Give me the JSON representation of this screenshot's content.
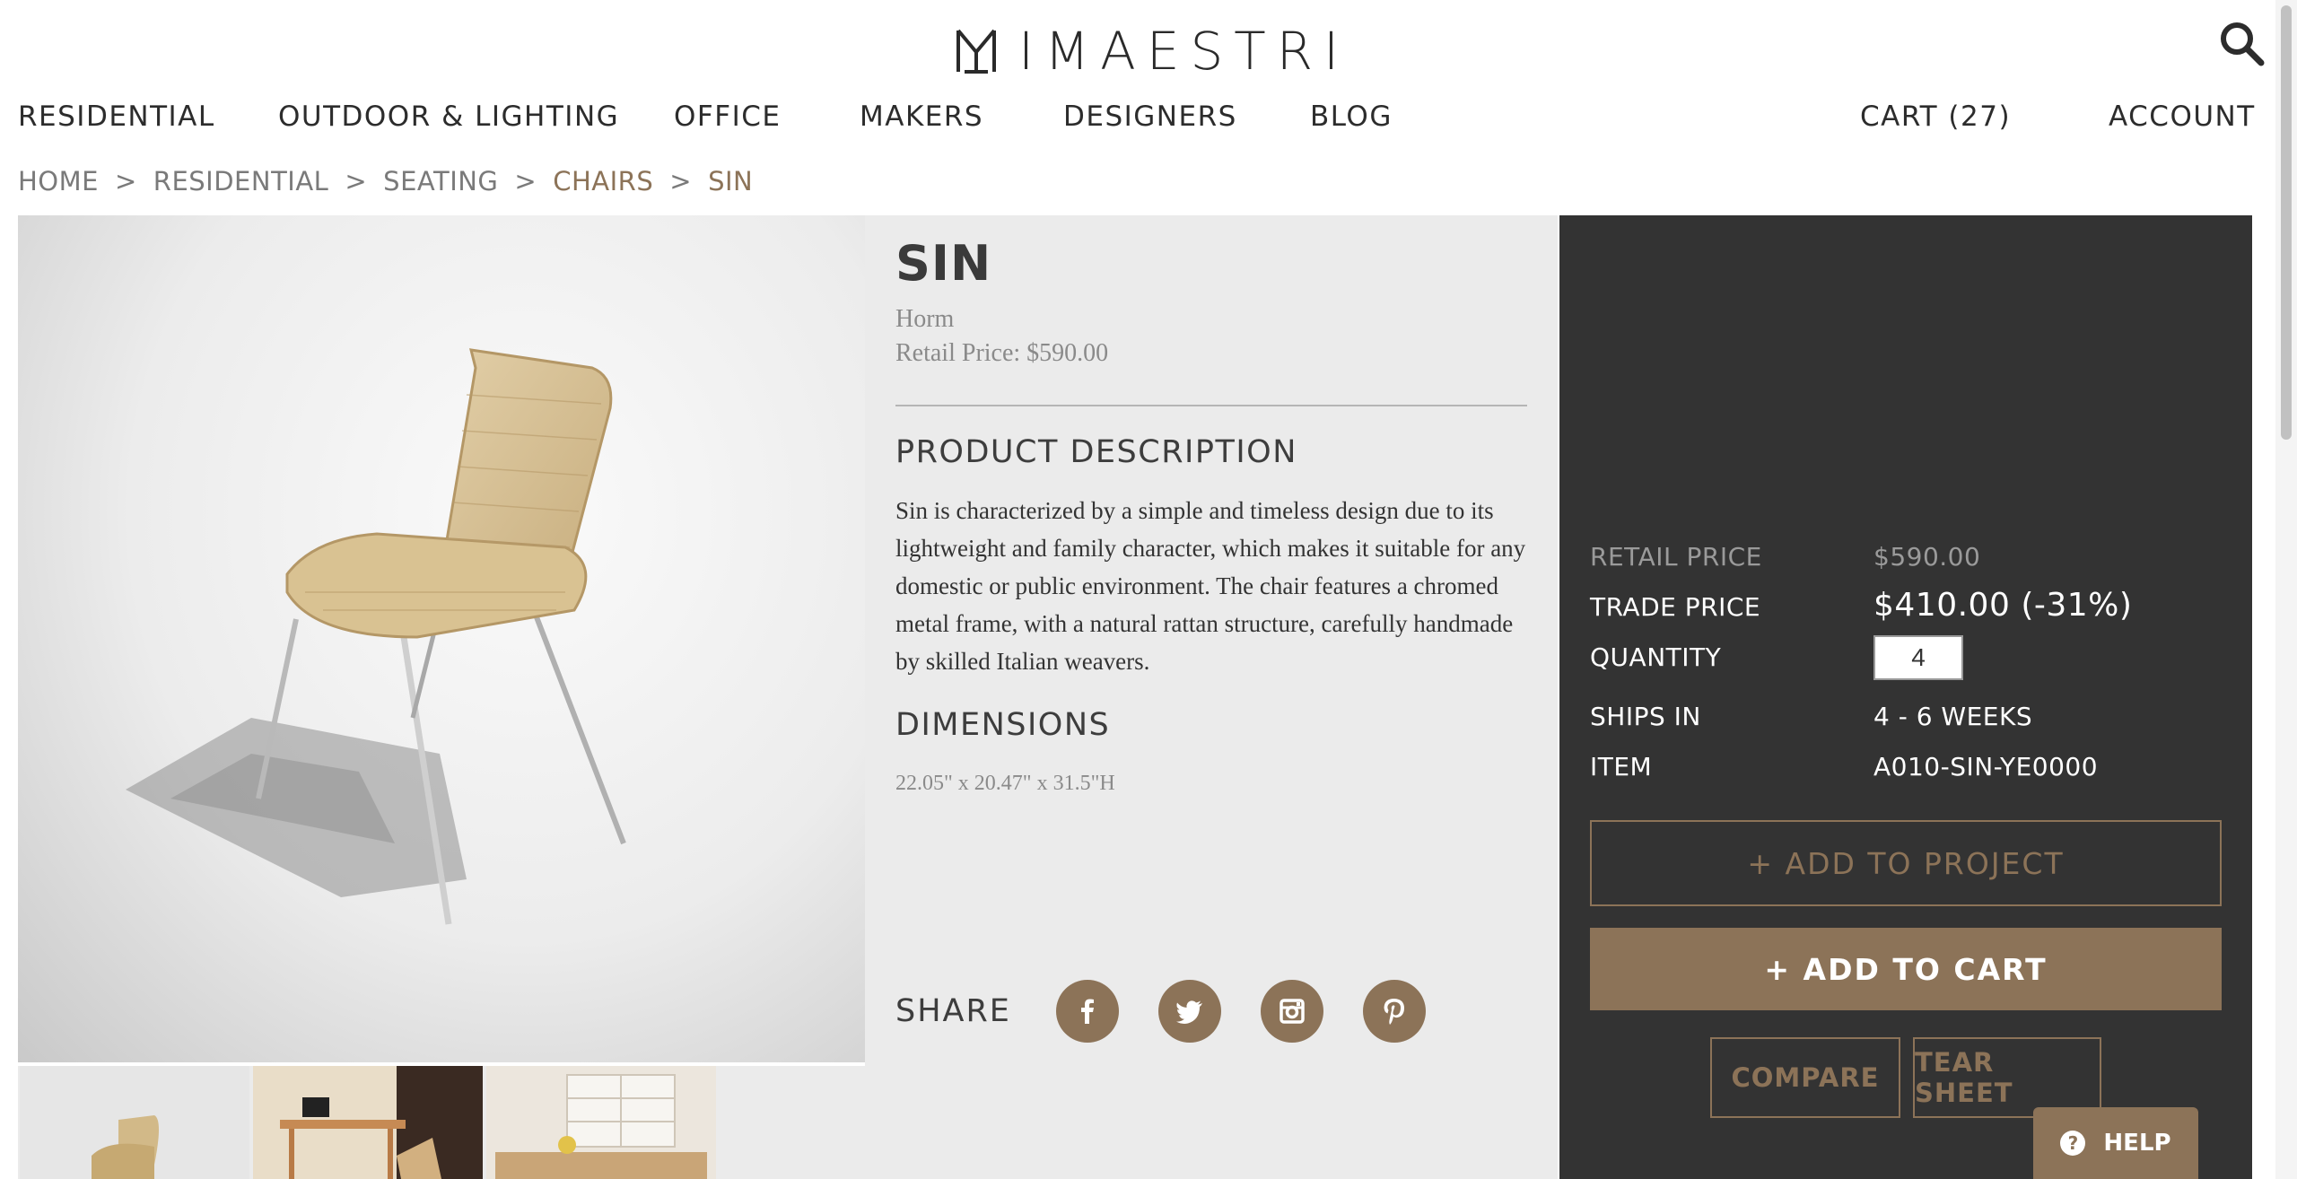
{
  "header": {
    "logo_text": "IMAESTRI",
    "search_icon": "search-icon"
  },
  "nav": {
    "items": [
      {
        "label": "RESIDENTIAL"
      },
      {
        "label": "OUTDOOR & LIGHTING"
      },
      {
        "label": "OFFICE"
      },
      {
        "label": "MAKERS"
      },
      {
        "label": "DESIGNERS"
      },
      {
        "label": "BLOG"
      }
    ],
    "cart_label": "CART (27)",
    "account_label": "ACCOUNT"
  },
  "breadcrumb": {
    "items": [
      {
        "label": "HOME"
      },
      {
        "label": "RESIDENTIAL"
      },
      {
        "label": "SEATING"
      },
      {
        "label": "CHAIRS"
      },
      {
        "label": "SIN"
      }
    ],
    "separator": ">"
  },
  "product": {
    "name": "SIN",
    "brand": "Horm",
    "retail_line": "Retail Price: $590.00",
    "description_heading": "PRODUCT DESCRIPTION",
    "description": "Sin is characterized by a simple and timeless design due to its lightweight and family character, which makes it suitable for any domestic or public environment. The chair features a chromed metal frame, with a natural rattan structure, carefully handmade by skilled Italian weavers.",
    "dimensions_heading": "DIMENSIONS",
    "dimensions": "22.05\" x 20.47\" x 31.5\"H",
    "share_label": "SHARE",
    "social_icons": [
      "facebook-icon",
      "twitter-icon",
      "instagram-icon",
      "pinterest-icon"
    ]
  },
  "purchase": {
    "retail_price_label": "RETAIL PRICE",
    "retail_price_value": "$590.00",
    "trade_price_label": "TRADE PRICE",
    "trade_price_value": "$410.00 (-31%)",
    "quantity_label": "QUANTITY",
    "quantity_value": "4",
    "ships_in_label": "SHIPS IN",
    "ships_in_value": "4 - 6 WEEKS",
    "item_label": "ITEM",
    "item_value": "A010-SIN-YE0000",
    "add_to_project_label": "+ ADD TO PROJECT",
    "add_to_cart_label": "+ ADD TO CART",
    "compare_label": "COMPARE",
    "tear_sheet_label": "TEAR SHEET"
  },
  "help": {
    "label": "HELP",
    "icon_glyph": "?"
  },
  "colors": {
    "accent": "#8c7358",
    "panel_bg": "#333333",
    "info_bg": "#ebebeb"
  }
}
